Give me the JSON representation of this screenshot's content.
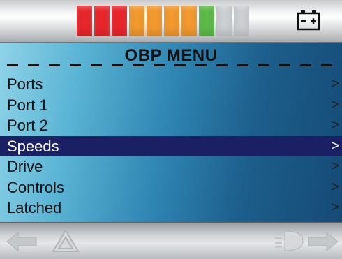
{
  "status_bar": {
    "battery_segments": [
      {
        "color": "#e8262b"
      },
      {
        "color": "#e8262b"
      },
      {
        "color": "#e8262b"
      },
      {
        "color": "#f39a2e"
      },
      {
        "color": "#f39a2e"
      },
      {
        "color": "#f39a2e"
      },
      {
        "color": "#f39a2e"
      },
      {
        "color": "#5dbb47"
      },
      {
        "color": "#cdd0d3"
      },
      {
        "color": "#cdd0d3"
      }
    ],
    "battery_icon": "battery-icon"
  },
  "menu": {
    "title": "OBP MENU",
    "items": [
      {
        "label": "Ports",
        "arrow": ">"
      },
      {
        "label": "Port 1",
        "arrow": ">"
      },
      {
        "label": "Port 2",
        "arrow": ">"
      },
      {
        "label": "Speeds",
        "arrow": ">",
        "selected": true
      },
      {
        "label": "Drive",
        "arrow": ">"
      },
      {
        "label": "Controls",
        "arrow": ">"
      },
      {
        "label": "Latched",
        "arrow": ">"
      }
    ]
  },
  "bottom_bar": {
    "icons": [
      "left-arrow-icon",
      "hazard-warning-icon",
      "headlight-icon",
      "right-arrow-icon"
    ]
  },
  "colors": {
    "selection": "#1b1f64",
    "menu_gradient_light": "#8fd3e8",
    "menu_gradient_dark": "#154a75"
  }
}
